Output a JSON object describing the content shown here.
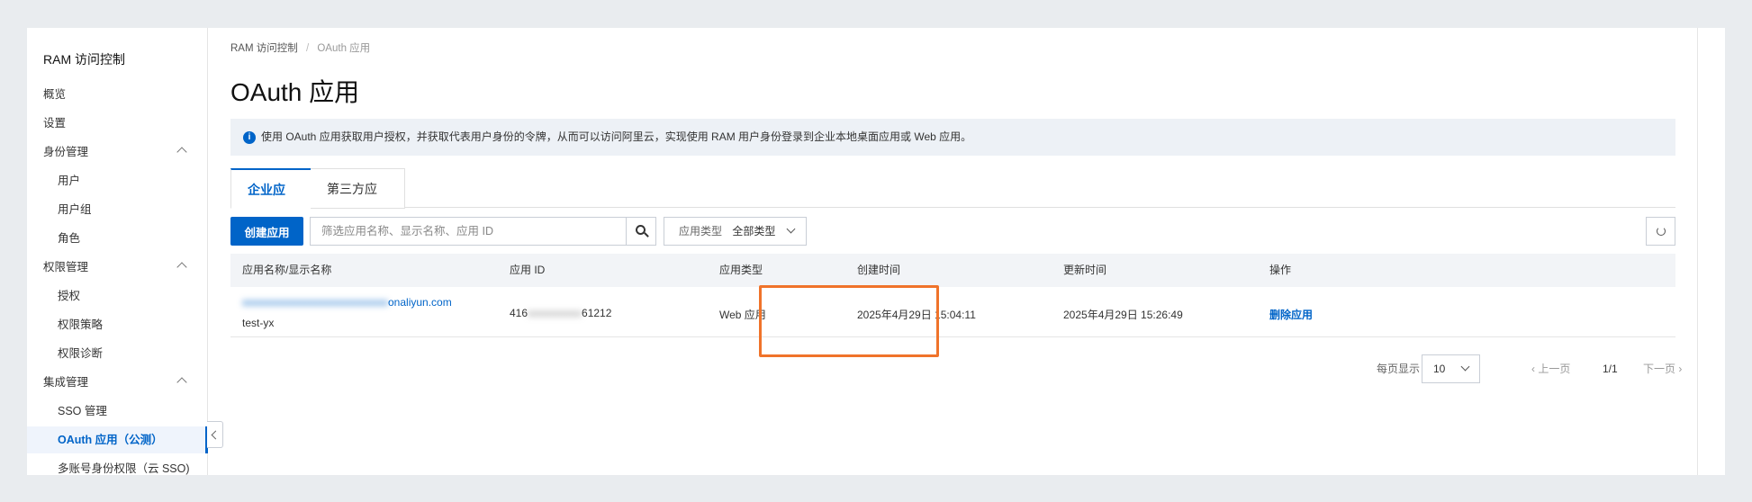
{
  "sidebar": {
    "title": "RAM 访问控制",
    "items": [
      {
        "label": "概览"
      },
      {
        "label": "设置"
      },
      {
        "label": "身份管理"
      },
      {
        "label": "用户"
      },
      {
        "label": "用户组"
      },
      {
        "label": "角色"
      },
      {
        "label": "权限管理"
      },
      {
        "label": "授权"
      },
      {
        "label": "权限策略"
      },
      {
        "label": "权限诊断"
      },
      {
        "label": "集成管理"
      },
      {
        "label": "SSO 管理"
      },
      {
        "label": "OAuth 应用（公测）"
      },
      {
        "label": "多账号身份权限（云 SSO)"
      }
    ]
  },
  "breadcrumb": {
    "root": "RAM 访问控制",
    "separator": "/",
    "current": "OAuth 应用"
  },
  "page": {
    "title": "OAuth 应用"
  },
  "alert": {
    "text": "使用 OAuth 应用获取用户授权，并获取代表用户身份的令牌，从而可以访问阿里云，实现使用 RAM 用户身份登录到企业本地桌面应用或 Web 应用。"
  },
  "tabs": [
    {
      "label": "企业应用"
    },
    {
      "label": "第三方应用"
    }
  ],
  "toolbar": {
    "create_label": "创建应用",
    "search_placeholder": "筛选应用名称、显示名称、应用 ID",
    "type_filter_label": "应用类型",
    "type_filter_value": "全部类型"
  },
  "table": {
    "headers": [
      "应用名称/显示名称",
      "应用 ID",
      "应用类型",
      "创建时间",
      "更新时间",
      "操作"
    ],
    "rows": [
      {
        "name_visible_suffix": "onaliyun.com",
        "display_name": "test-yx",
        "app_id_prefix": "416",
        "app_id_suffix": "61212",
        "type": "Web 应用",
        "created": "2025年4月29日 15:04:11",
        "updated": "2025年4月29日 15:26:49",
        "action": "删除应用"
      }
    ]
  },
  "pagination": {
    "page_size_label": "每页显示",
    "page_size": "10",
    "prev": "上一页",
    "position": "1/1",
    "next": "下一页"
  },
  "colors": {
    "primary": "#0064c8",
    "highlight": "#f0732a",
    "header_bg": "#f2f4f7",
    "alert_bg": "#edf1f6"
  }
}
